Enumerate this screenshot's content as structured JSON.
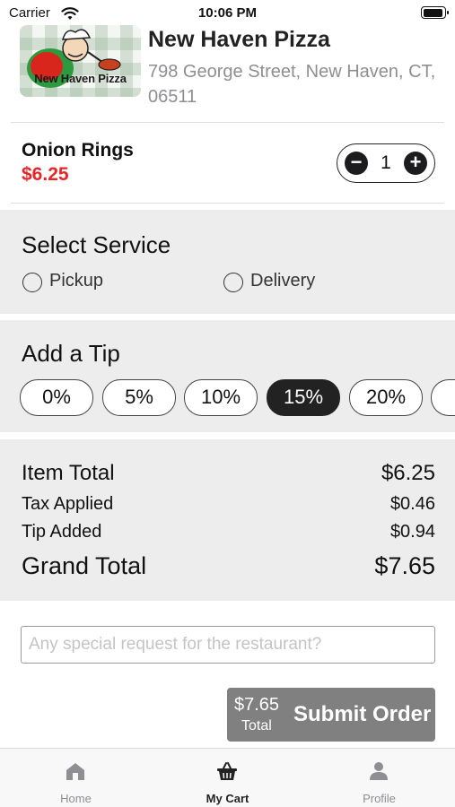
{
  "status_bar": {
    "carrier": "Carrier",
    "time": "10:06 PM"
  },
  "restaurant": {
    "logo_text": "New Haven Pizza",
    "name": "New Haven Pizza",
    "address": "798 George Street, New Haven, CT, 06511"
  },
  "item": {
    "name": "Onion Rings",
    "price": "$6.25",
    "quantity": "1",
    "minus": "−",
    "plus": "+"
  },
  "service": {
    "title": "Select Service",
    "options": [
      "Pickup",
      "Delivery"
    ]
  },
  "tip": {
    "title": "Add a Tip",
    "options": [
      "0%",
      "5%",
      "10%",
      "15%",
      "20%"
    ],
    "selected": "15%"
  },
  "totals": {
    "item_total_label": "Item Total",
    "item_total": "$6.25",
    "tax_label": "Tax Applied",
    "tax": "$0.46",
    "tip_label": "Tip Added",
    "tip": "$0.94",
    "grand_label": "Grand Total",
    "grand": "$7.65"
  },
  "special_request": {
    "placeholder": "Any special request for the restaurant?",
    "value": ""
  },
  "submit": {
    "amount": "$7.65",
    "total_label": "Total",
    "label": "Submit Order"
  },
  "tab_bar": {
    "items": [
      {
        "label": "Home",
        "icon": "home-icon"
      },
      {
        "label": "My Cart",
        "icon": "basket-icon"
      },
      {
        "label": "Profile",
        "icon": "person-icon"
      }
    ],
    "active": "My Cart"
  },
  "colors": {
    "price_red": "#e8262a",
    "section_bg": "#ededed",
    "active_pill": "#222222",
    "submit_bg": "#808080"
  }
}
